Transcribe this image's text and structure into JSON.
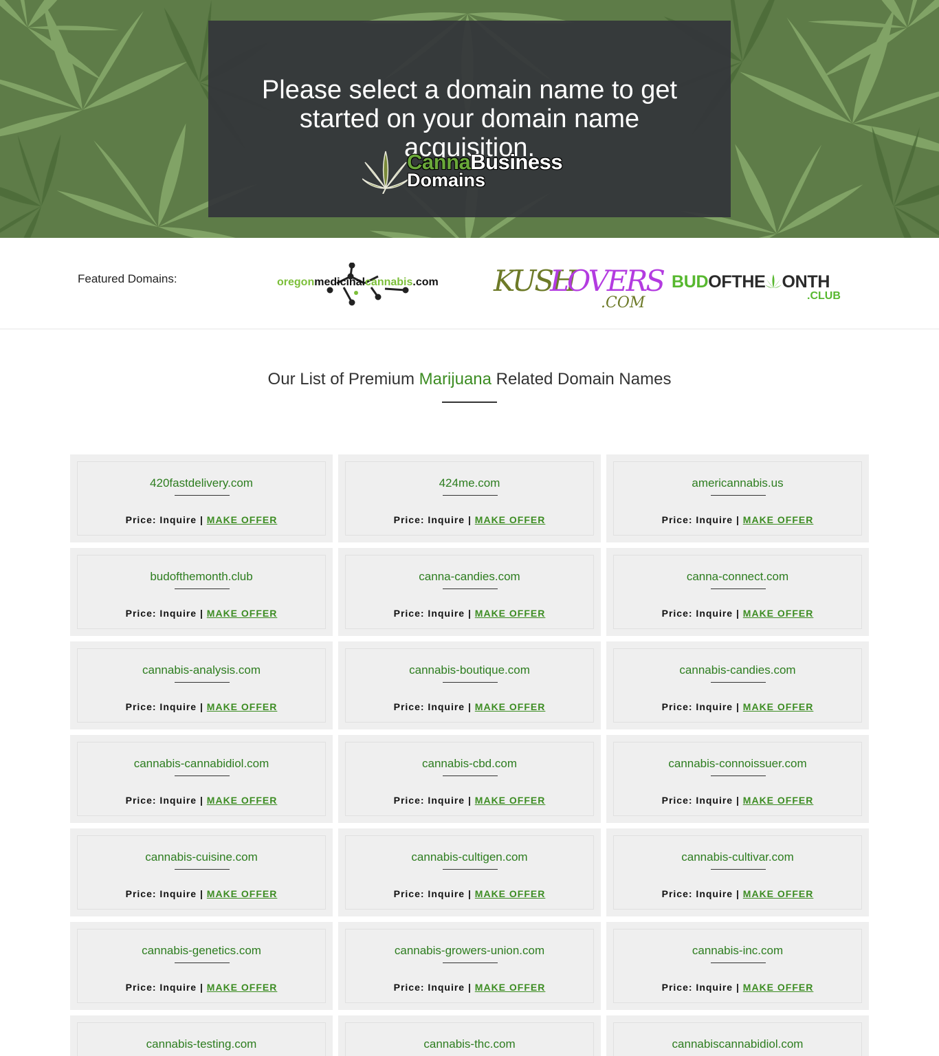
{
  "hero": {
    "title": "Please select a domain name to get started on your domain name acquisition.",
    "brand_canna": "Canna",
    "brand_business": "Business",
    "brand_domains": "Domains",
    "leaf_icon": "cannabis-leaf-icon"
  },
  "featured": {
    "label": "Featured Domains:",
    "logos": [
      {
        "parts": [
          "oregon",
          "medicinal",
          "cannabis",
          ".com"
        ],
        "icon": "molecule-icon"
      },
      {
        "parts": [
          "KUSH",
          "LOVERS",
          ".COM"
        ]
      },
      {
        "parts": [
          "BUD",
          "OFTHE",
          "ONTH",
          ".CLUB"
        ],
        "icon": "cannabis-leaf-icon"
      }
    ]
  },
  "section": {
    "title_pre": "Our List of Premium ",
    "title_highlight": "Marijuana",
    "title_post": " Related Domain Names"
  },
  "price_label": "Price: Inquire | ",
  "offer_label": "MAKE OFFER",
  "domains": [
    "420fastdelivery.com",
    "424me.com",
    "americannabis.us",
    "budofthemonth.club",
    "canna-candies.com",
    "canna-connect.com",
    "cannabis-analysis.com",
    "cannabis-boutique.com",
    "cannabis-candies.com",
    "cannabis-cannabidiol.com",
    "cannabis-cbd.com",
    "cannabis-connoissuer.com",
    "cannabis-cuisine.com",
    "cannabis-cultigen.com",
    "cannabis-cultivar.com",
    "cannabis-genetics.com",
    "cannabis-growers-union.com",
    "cannabis-inc.com",
    "cannabis-testing.com",
    "cannabis-thc.com",
    "cannabiscannabidiol.com"
  ],
  "colors": {
    "accent_green": "#3c8c22",
    "hero_box": "#34363a",
    "card_bg": "#efefef"
  }
}
